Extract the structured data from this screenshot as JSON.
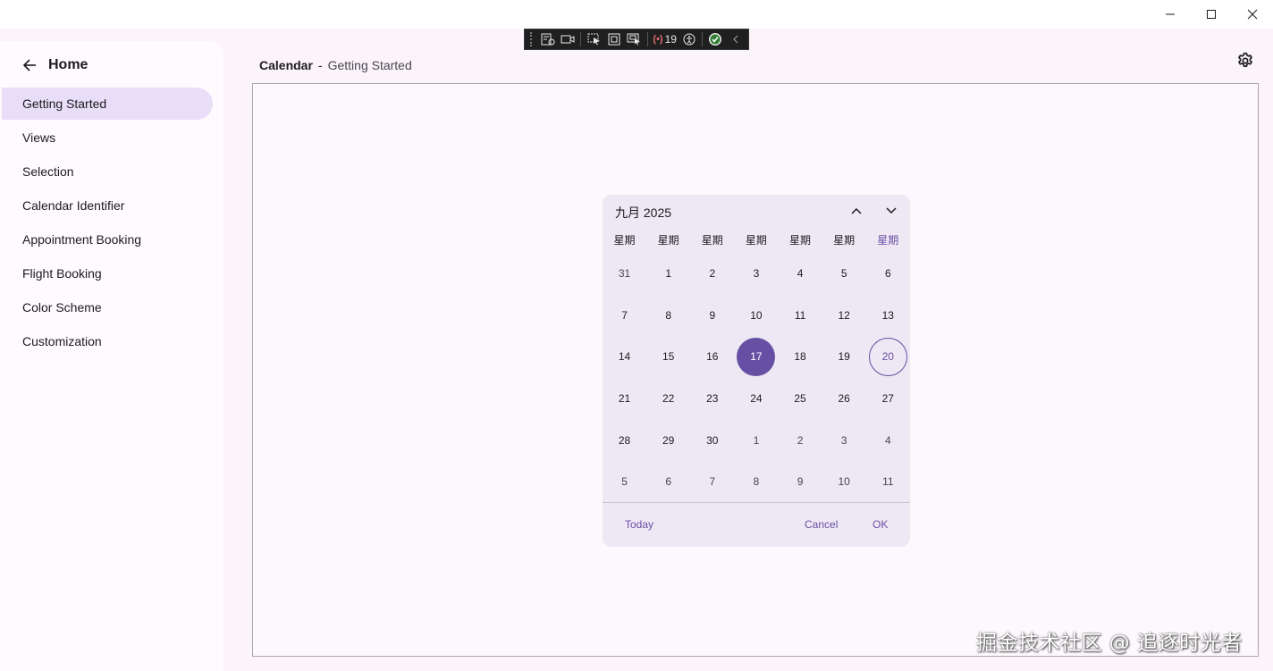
{
  "window": {
    "controls": [
      "minimize-icon",
      "maximize-icon",
      "close-icon"
    ]
  },
  "debug_toolbar": {
    "binding_errors": "19"
  },
  "sidebar": {
    "home_label": "Home",
    "items": [
      {
        "label": "Getting Started",
        "active": true
      },
      {
        "label": "Views"
      },
      {
        "label": "Selection"
      },
      {
        "label": "Calendar Identifier"
      },
      {
        "label": "Appointment Booking"
      },
      {
        "label": "Flight Booking"
      },
      {
        "label": "Color Scheme"
      },
      {
        "label": "Customization"
      }
    ]
  },
  "header": {
    "title": "Calendar",
    "separator": "-",
    "subtitle": "Getting Started"
  },
  "calendar": {
    "month_year": "九月 2025",
    "weekdays": [
      "星期",
      "星期",
      "星期",
      "星期",
      "星期",
      "星期",
      "星期"
    ],
    "days": [
      [
        "31",
        "1",
        "2",
        "3",
        "4",
        "5",
        "6"
      ],
      [
        "7",
        "8",
        "9",
        "10",
        "11",
        "12",
        "13"
      ],
      [
        "14",
        "15",
        "16",
        "17",
        "18",
        "19",
        "20"
      ],
      [
        "21",
        "22",
        "23",
        "24",
        "25",
        "26",
        "27"
      ],
      [
        "28",
        "29",
        "30",
        "1",
        "2",
        "3",
        "4"
      ],
      [
        "5",
        "6",
        "7",
        "8",
        "9",
        "10",
        "11"
      ]
    ],
    "selected_day": "17",
    "today_day": "20",
    "buttons": {
      "today": "Today",
      "cancel": "Cancel",
      "ok": "OK"
    },
    "accent_color": "#6750a4"
  },
  "watermark": "掘金技术社区 @ 追逐时光者"
}
